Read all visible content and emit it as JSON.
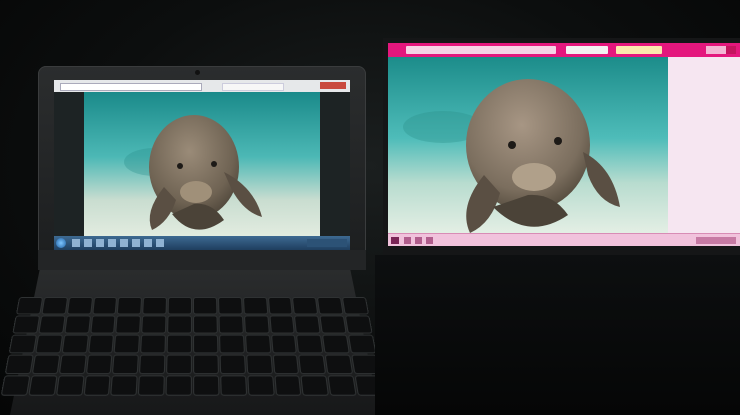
{
  "scene": {
    "description_type": "photo",
    "devices": [
      "laptop",
      "monitor"
    ]
  },
  "colors": {
    "water_light": "#6fd0cf",
    "water_deep": "#16817e",
    "sand": "#d8e6d7",
    "manatee": "#8a7c6b",
    "monitor_accent": "#e4177d",
    "laptop_taskbar": "#2f557e"
  },
  "icons": {
    "windows_start": "windows-start-icon",
    "browser_tabs": "browser-tab-icon"
  }
}
